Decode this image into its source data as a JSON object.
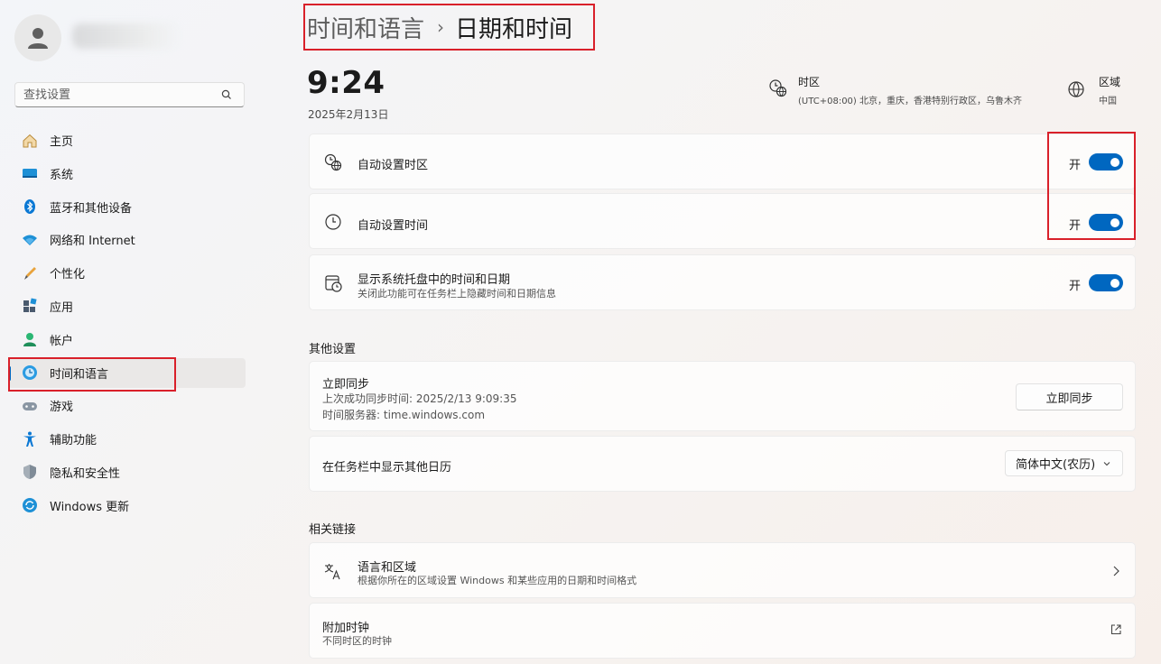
{
  "sidebar": {
    "search_placeholder": "查找设置",
    "items": [
      {
        "label": "主页",
        "icon": "home-icon"
      },
      {
        "label": "系统",
        "icon": "system-display-icon"
      },
      {
        "label": "蓝牙和其他设备",
        "icon": "bluetooth-icon"
      },
      {
        "label": "网络和 Internet",
        "icon": "wifi-icon"
      },
      {
        "label": "个性化",
        "icon": "brush-icon"
      },
      {
        "label": "应用",
        "icon": "apps-icon"
      },
      {
        "label": "帐户",
        "icon": "account-icon"
      },
      {
        "label": "时间和语言",
        "icon": "time-language-icon",
        "active": true
      },
      {
        "label": "游戏",
        "icon": "gamepad-icon"
      },
      {
        "label": "辅助功能",
        "icon": "accessibility-icon"
      },
      {
        "label": "隐私和安全性",
        "icon": "shield-icon"
      },
      {
        "label": "Windows 更新",
        "icon": "windows-update-icon"
      }
    ]
  },
  "header": {
    "parent": "时间和语言",
    "separator": "›",
    "current": "日期和时间"
  },
  "clock": {
    "time": "9:24",
    "date": "2025年2月13日"
  },
  "timezone": {
    "title": "时区",
    "value": "(UTC+08:00) 北京，重庆，香港特别行政区，乌鲁木齐"
  },
  "region": {
    "title": "区域",
    "value": "中国"
  },
  "settings": {
    "auto_timezone": {
      "label": "自动设置时区",
      "state": "开",
      "on": true
    },
    "auto_time": {
      "label": "自动设置时间",
      "state": "开",
      "on": true
    },
    "tray": {
      "label": "显示系统托盘中的时间和日期",
      "sub": "关闭此功能可在任务栏上隐藏时间和日期信息",
      "state": "开",
      "on": true
    }
  },
  "other": {
    "heading": "其他设置",
    "sync": {
      "title": "立即同步",
      "last_sync": "上次成功同步时间: 2025/2/13 9:09:35",
      "server": "时间服务器: time.windows.com",
      "button": "立即同步"
    },
    "calendar": {
      "label": "在任务栏中显示其他日历",
      "selected": "简体中文(农历)"
    }
  },
  "related": {
    "heading": "相关链接",
    "language_region": {
      "title": "语言和区域",
      "sub": "根据你所在的区域设置 Windows 和某些应用的日期和时间格式"
    },
    "extra_clocks": {
      "title": "附加时钟",
      "sub": "不同时区的时钟"
    }
  },
  "colors": {
    "accent": "#0067c0",
    "highlight": "#d9202a"
  }
}
